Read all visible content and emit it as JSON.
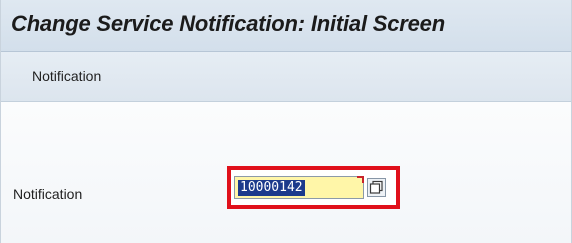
{
  "window": {
    "title": "Change Service Notification: Initial Screen"
  },
  "menu": {
    "items": [
      {
        "label": "Notification"
      }
    ]
  },
  "form": {
    "notification_label": "Notification",
    "notification_value": "10000142",
    "value_help_icon": "value-help-icon"
  },
  "colors": {
    "highlight": "#e0101a",
    "selection": "#1c3a8c",
    "input_bg": "#fff6a8"
  }
}
